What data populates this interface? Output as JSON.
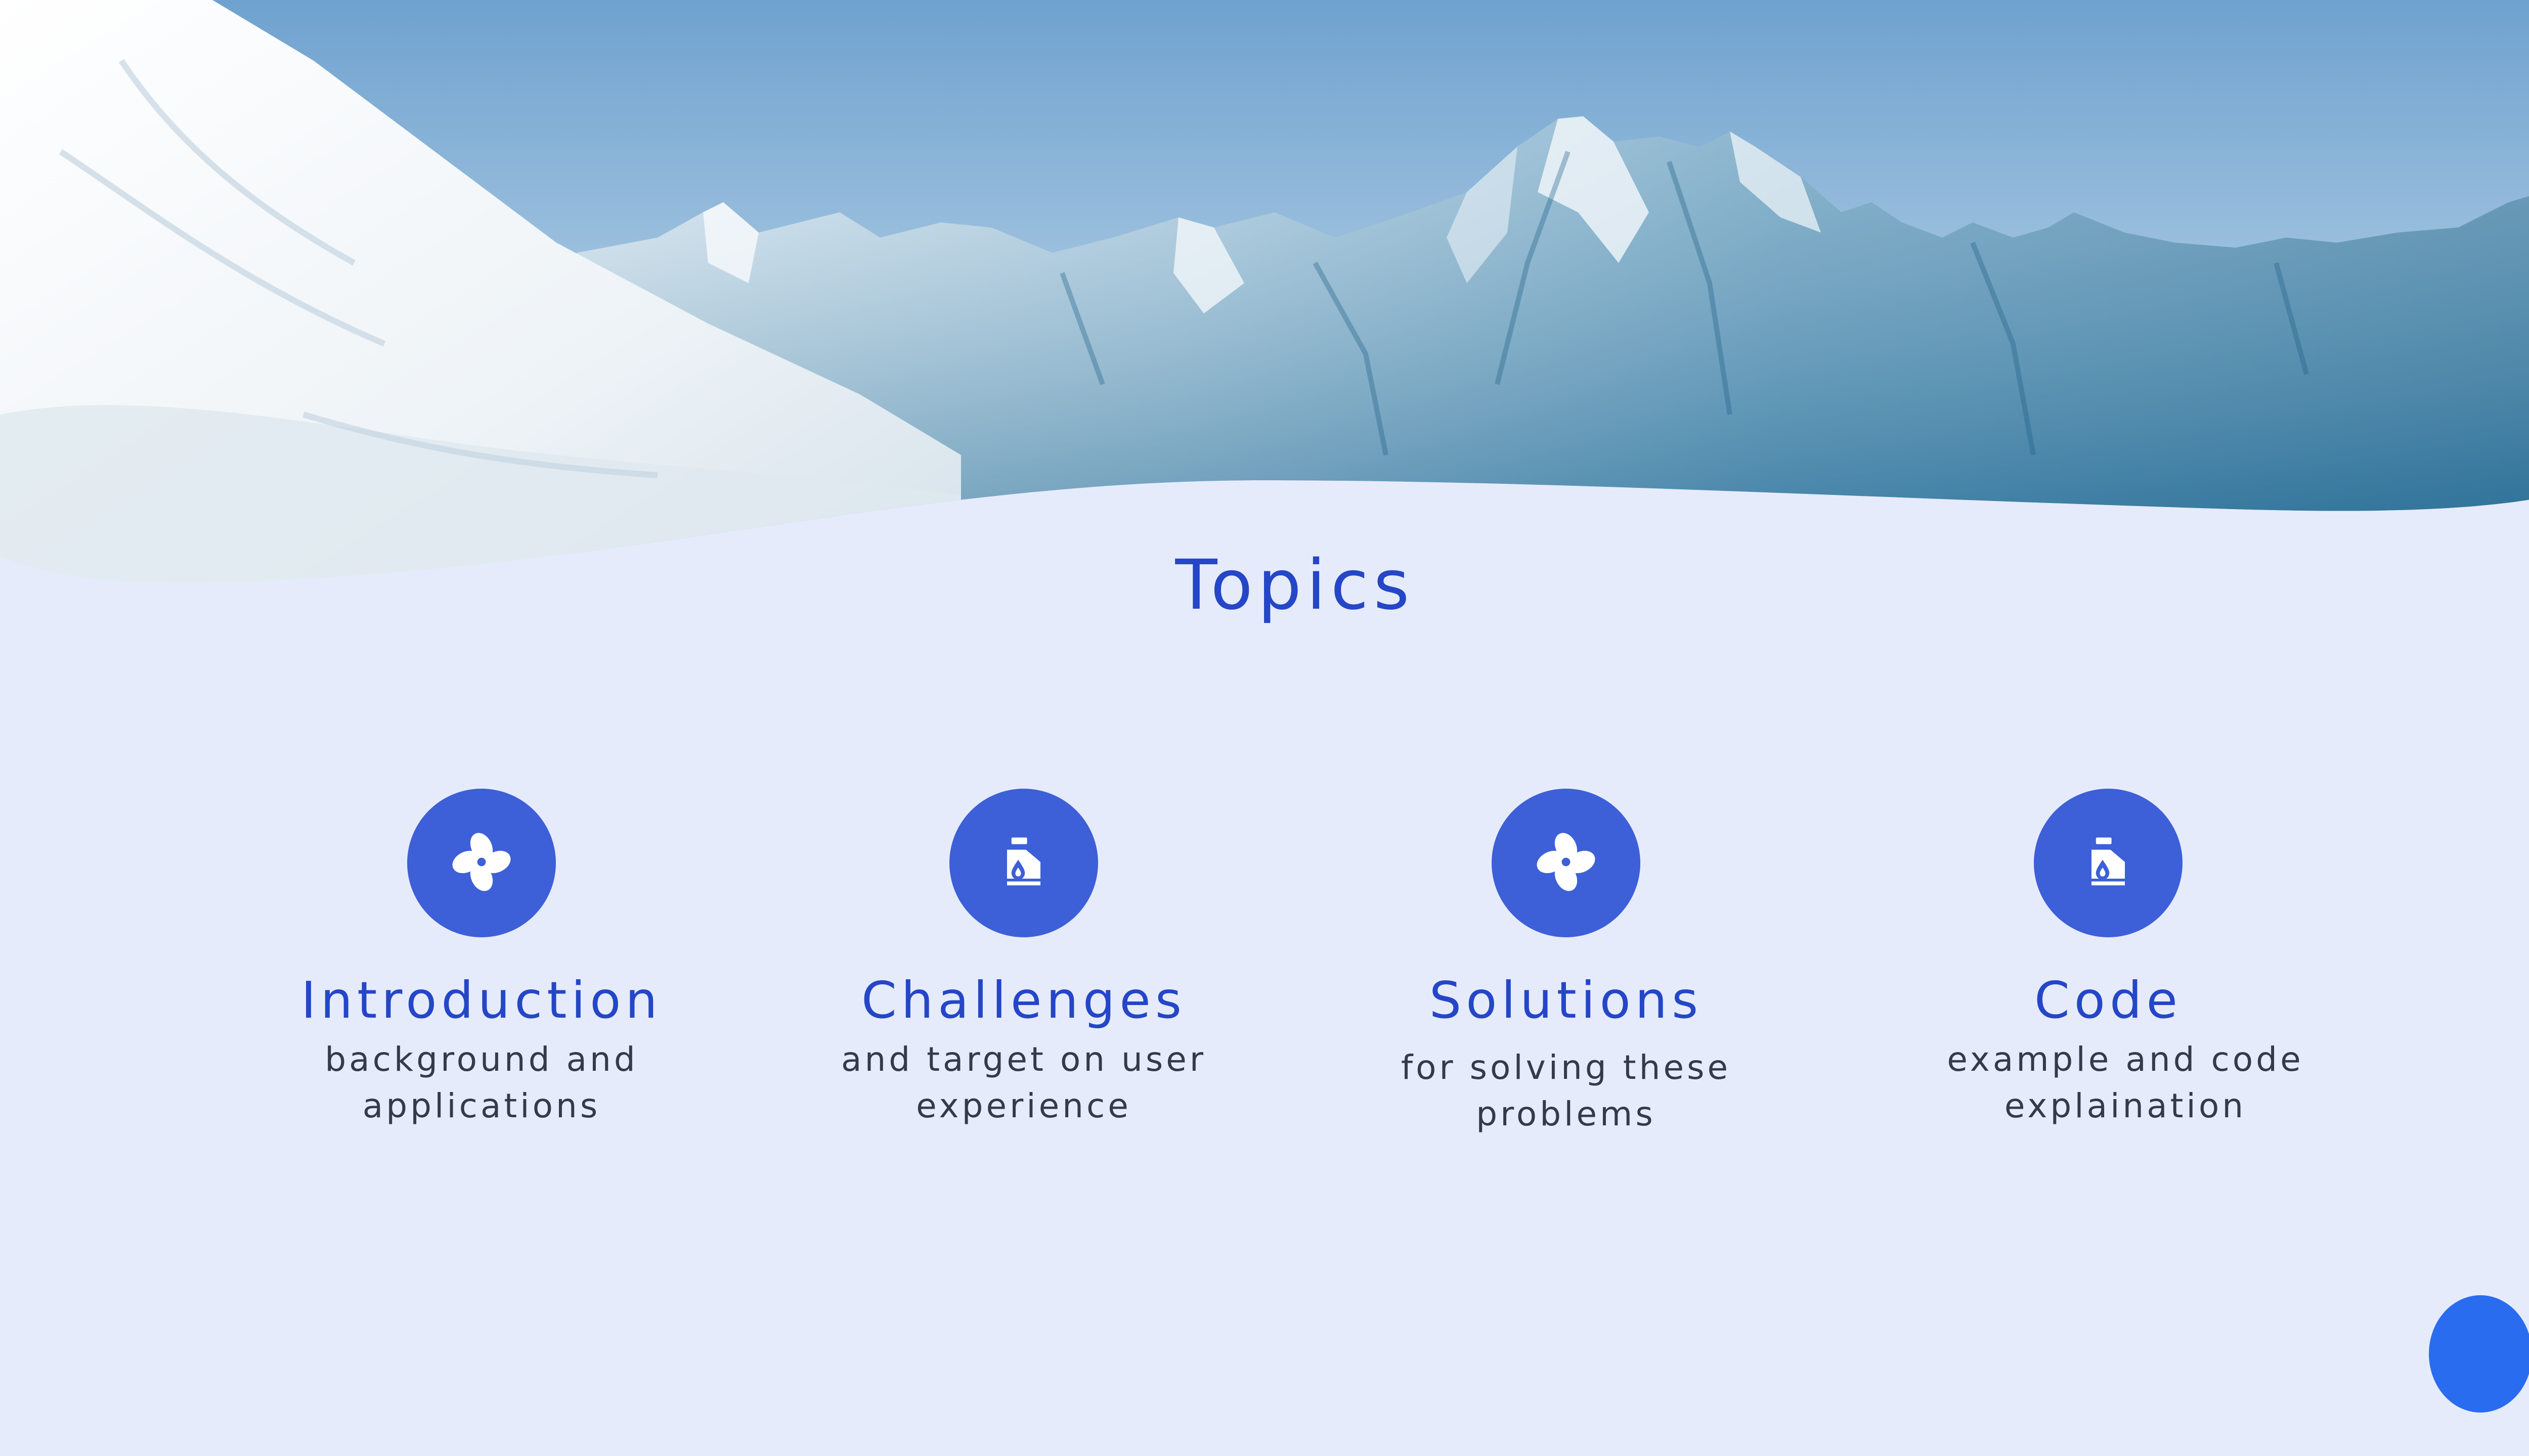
{
  "slide": {
    "title": "Topics",
    "topics": [
      {
        "icon": "fan-icon",
        "heading": "Introduction",
        "desc_line1": "background and",
        "desc_line2": "applications"
      },
      {
        "icon": "oil-bottle-icon",
        "heading": "Challenges",
        "desc_line1": "and target on user",
        "desc_line2": "experience"
      },
      {
        "icon": "fan-icon",
        "heading": "Solutions",
        "desc_line1": "for solving these",
        "desc_line2": "problems"
      },
      {
        "icon": "oil-bottle-icon",
        "heading": "Code",
        "desc_line1": "example and code",
        "desc_line2": "explaination"
      }
    ]
  },
  "colors": {
    "background": "#e6ebfc",
    "accent": "#2446c7",
    "icon_circle": "#3d5fd7",
    "decor_dots": "#2a6cf0"
  }
}
